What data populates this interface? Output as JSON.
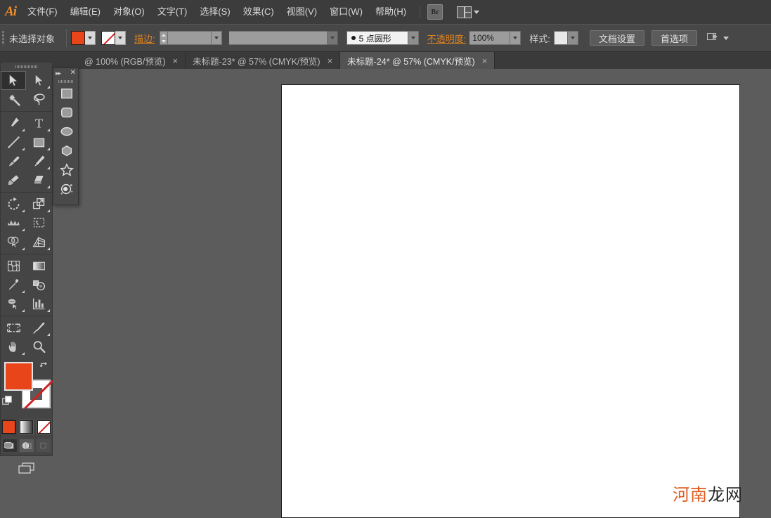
{
  "app": {
    "name": "Adobe Illustrator",
    "logo_text": "Ai"
  },
  "menubar": {
    "items": [
      {
        "label": "文件(F)",
        "name": "menu-file"
      },
      {
        "label": "编辑(E)",
        "name": "menu-edit"
      },
      {
        "label": "对象(O)",
        "name": "menu-object"
      },
      {
        "label": "文字(T)",
        "name": "menu-type"
      },
      {
        "label": "选择(S)",
        "name": "menu-select"
      },
      {
        "label": "效果(C)",
        "name": "menu-effect"
      },
      {
        "label": "视图(V)",
        "name": "menu-view"
      },
      {
        "label": "窗口(W)",
        "name": "menu-window"
      },
      {
        "label": "帮助(H)",
        "name": "menu-help"
      }
    ],
    "bridge_label": "Br",
    "layout_label": ""
  },
  "controlbar": {
    "selection_status": "未选择对象",
    "fill_color": "#e8451a",
    "stroke_color": "none",
    "stroke_label": "描边:",
    "stroke_weight": "",
    "stroke_profile": "",
    "brush_definition": "5 点圆形",
    "opacity_label": "不透明度:",
    "opacity_value": "100%",
    "style_label": "样式:",
    "document_setup_label": "文档设置",
    "preferences_label": "首选项"
  },
  "tabs": [
    {
      "label": "@ 100% (RGB/预览)",
      "active": false,
      "name": "doc-tab-1"
    },
    {
      "label": "未标题-23* @ 57% (CMYK/预览)",
      "active": false,
      "name": "doc-tab-2"
    },
    {
      "label": "未标题-24* @ 57% (CMYK/预览)",
      "active": true,
      "name": "doc-tab-3"
    }
  ],
  "tab_close_glyph": "×",
  "toolbar": {
    "tools": [
      {
        "name": "selection-tool",
        "selected": true,
        "flyout": false
      },
      {
        "name": "direct-selection-tool",
        "selected": false,
        "flyout": true
      },
      {
        "name": "magic-wand-tool",
        "selected": false,
        "flyout": false
      },
      {
        "name": "lasso-tool",
        "selected": false,
        "flyout": false
      },
      {
        "name": "pen-tool",
        "selected": false,
        "flyout": true
      },
      {
        "name": "type-tool",
        "selected": false,
        "flyout": true
      },
      {
        "name": "line-segment-tool",
        "selected": false,
        "flyout": true
      },
      {
        "name": "rectangle-tool",
        "selected": false,
        "flyout": true
      },
      {
        "name": "paintbrush-tool",
        "selected": false,
        "flyout": false
      },
      {
        "name": "pencil-tool",
        "selected": false,
        "flyout": true
      },
      {
        "name": "blob-brush-tool",
        "selected": false,
        "flyout": false
      },
      {
        "name": "eraser-tool",
        "selected": false,
        "flyout": true
      },
      {
        "name": "rotate-tool",
        "selected": false,
        "flyout": true
      },
      {
        "name": "scale-tool",
        "selected": false,
        "flyout": true
      },
      {
        "name": "width-tool",
        "selected": false,
        "flyout": true
      },
      {
        "name": "free-transform-tool",
        "selected": false,
        "flyout": false
      },
      {
        "name": "shape-builder-tool",
        "selected": false,
        "flyout": true
      },
      {
        "name": "perspective-grid-tool",
        "selected": false,
        "flyout": true
      },
      {
        "name": "mesh-tool",
        "selected": false,
        "flyout": false
      },
      {
        "name": "gradient-tool",
        "selected": false,
        "flyout": false
      },
      {
        "name": "eyedropper-tool",
        "selected": false,
        "flyout": true
      },
      {
        "name": "blend-tool",
        "selected": false,
        "flyout": false
      },
      {
        "name": "symbol-sprayer-tool",
        "selected": false,
        "flyout": true
      },
      {
        "name": "column-graph-tool",
        "selected": false,
        "flyout": true
      },
      {
        "name": "artboard-tool",
        "selected": false,
        "flyout": false
      },
      {
        "name": "slice-tool",
        "selected": false,
        "flyout": true
      },
      {
        "name": "hand-tool",
        "selected": false,
        "flyout": true
      },
      {
        "name": "zoom-tool",
        "selected": false,
        "flyout": false
      }
    ],
    "fill_color": "#e8451a",
    "stroke_color": "#ffffff",
    "stroke_is_none": true,
    "color_modes": [
      {
        "name": "color-mode-solid",
        "active": true
      },
      {
        "name": "color-mode-gradient",
        "active": false
      },
      {
        "name": "color-mode-none",
        "active": false
      }
    ],
    "draw_modes": [
      {
        "name": "draw-normal-mode",
        "active": true,
        "disabled": false
      },
      {
        "name": "draw-behind-mode",
        "active": false,
        "disabled": false
      },
      {
        "name": "draw-inside-mode",
        "active": false,
        "disabled": true
      }
    ],
    "screen_mode_name": "change-screen-mode"
  },
  "shapes_panel": {
    "collapse_glyph": "▸▸",
    "close_glyph": "✕",
    "shapes": [
      {
        "name": "rectangle-shape-tool"
      },
      {
        "name": "rounded-rectangle-shape-tool"
      },
      {
        "name": "ellipse-shape-tool"
      },
      {
        "name": "polygon-shape-tool"
      },
      {
        "name": "star-shape-tool"
      },
      {
        "name": "flare-shape-tool"
      }
    ]
  },
  "canvas": {
    "artboard_color": "#ffffff",
    "background_color": "#5c5c5c"
  },
  "watermark": {
    "text_primary": "河南",
    "text_secondary": "龙网",
    "color_primary": "#e05a1e",
    "color_secondary": "#262626"
  }
}
